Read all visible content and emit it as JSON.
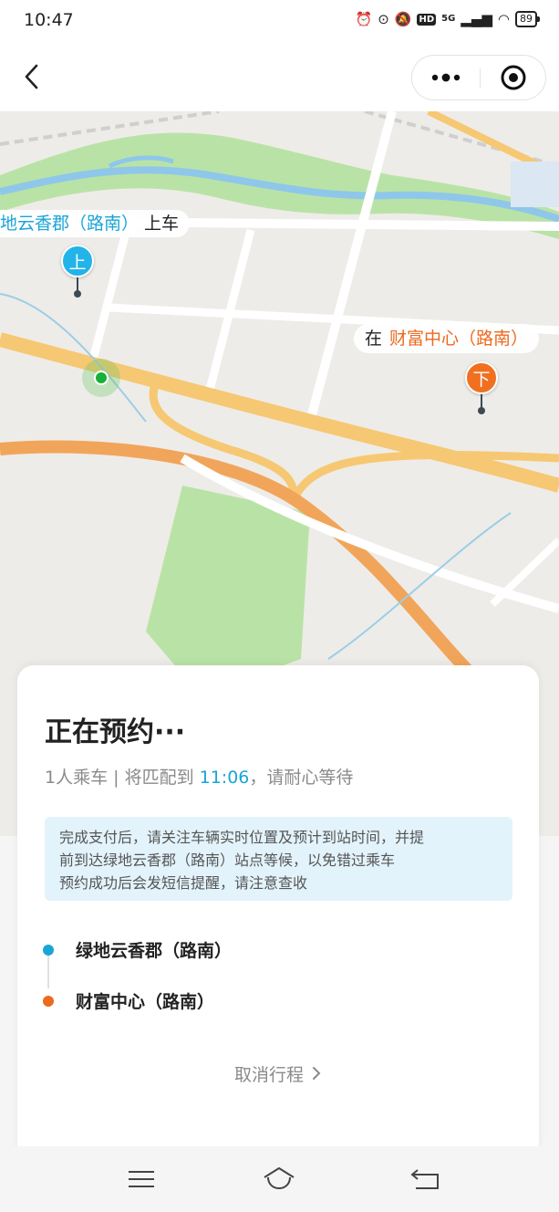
{
  "status_bar": {
    "time": "10:47",
    "network": "5G",
    "hd": "HD",
    "battery": "89",
    "icons": [
      "alarm-icon",
      "location-icon",
      "mute-icon",
      "hd-icon",
      "signal-icon",
      "wifi-icon",
      "battery-icon"
    ]
  },
  "nav": {
    "back_icon": "chevron-left-icon",
    "more_icon": "more-dots-icon",
    "target_icon": "target-icon"
  },
  "map": {
    "pickup_label": "地云香郡（路南）",
    "pickup_suffix": "上车",
    "pickup_pin": "上",
    "dropoff_prefix": "在",
    "dropoff_label": "财富中心（路南）",
    "dropoff_pin": "下",
    "pickup_color": "#22b4e8",
    "dropoff_color": "#f07020",
    "user_location_color": "#17b03a"
  },
  "booking": {
    "title": "正在预约···",
    "subtitle_prefix": "1人乘车 | 将匹配到 ",
    "match_time": "11:06",
    "subtitle_suffix": "，请耐心等待",
    "notice_lines": [
      "完成支付后，请关注车辆实时位置及预计到站时间，并提",
      "前到达绿地云香郡（路南）站点等候，以免错过乘车",
      "预约成功后会发短信提醒，请注意查收"
    ],
    "stops": [
      {
        "name": "绿地云香郡（路南）",
        "color": "#1aa5d6"
      },
      {
        "name": "财富中心（路南）",
        "color": "#ec6a1e"
      }
    ],
    "cancel_label": "取消行程",
    "cancel_icon": "chevron-right-icon",
    "accent_color": "#1aa5d6"
  },
  "system_nav": {
    "icons": [
      "menu-icon",
      "home-icon",
      "back-icon"
    ]
  }
}
